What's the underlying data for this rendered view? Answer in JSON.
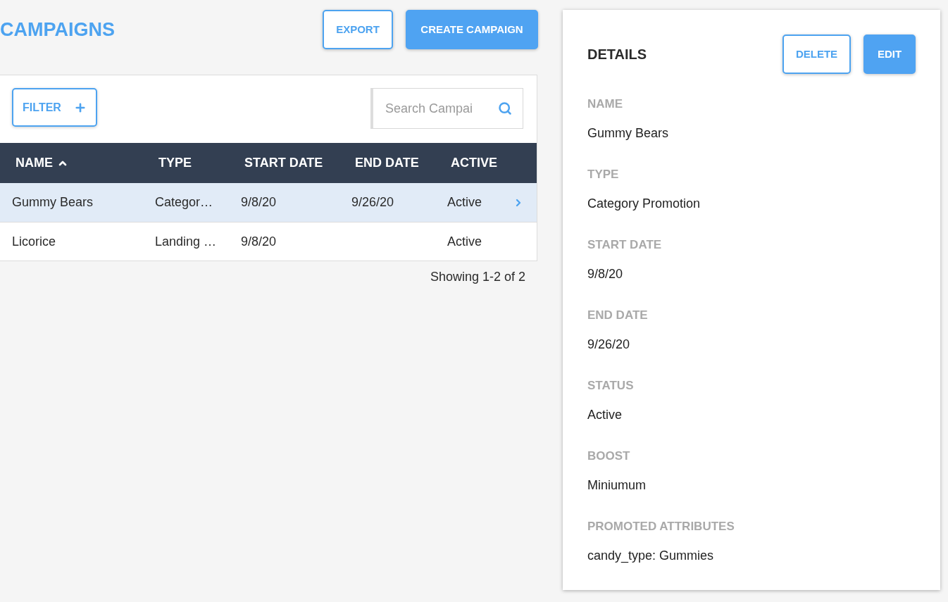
{
  "header": {
    "title": "CAMPAIGNS",
    "buttons": [
      {
        "label": "EXPORT",
        "kind": "outline"
      },
      {
        "label": "CREATE CAMPAIGN",
        "kind": "primary"
      }
    ]
  },
  "toolbar": {
    "filter_button": "FILTER",
    "search": {
      "placeholder": "Search Campai"
    }
  },
  "table": {
    "columns": [
      {
        "label": "NAME",
        "sorted": true
      },
      {
        "label": "TYPE",
        "sorted": false
      },
      {
        "label": "START DATE",
        "sorted": false
      },
      {
        "label": "END DATE",
        "sorted": false
      },
      {
        "label": "ACTIVE",
        "sorted": false
      }
    ],
    "rows": [
      {
        "name": "Gummy Bears",
        "type": "Categor…",
        "start_date": "9/8/20",
        "end_date": "9/26/20",
        "active": "Active",
        "selected": true
      },
      {
        "name": "Licorice",
        "type": "Landing …",
        "start_date": "9/8/20",
        "active": "Active",
        "selected": false
      }
    ]
  },
  "pagination": "Showing 1-2 of 2",
  "details": {
    "title": "DETAILS",
    "buttons": [
      {
        "label": "DELETE",
        "kind": "outline"
      },
      {
        "label": "EDIT",
        "kind": "primary"
      }
    ],
    "fields": [
      {
        "label": "NAME",
        "value": "Gummy Bears"
      },
      {
        "label": "TYPE",
        "value": "Category Promotion"
      },
      {
        "label": "START DATE",
        "value": "9/8/20"
      },
      {
        "label": "END DATE",
        "value": "9/26/20"
      },
      {
        "label": "STATUS",
        "value": "Active"
      },
      {
        "label": "BOOST",
        "value": "Miniumum"
      },
      {
        "label": "PROMOTED ATTRIBUTES",
        "value": "candy_type: Gummies"
      }
    ]
  }
}
